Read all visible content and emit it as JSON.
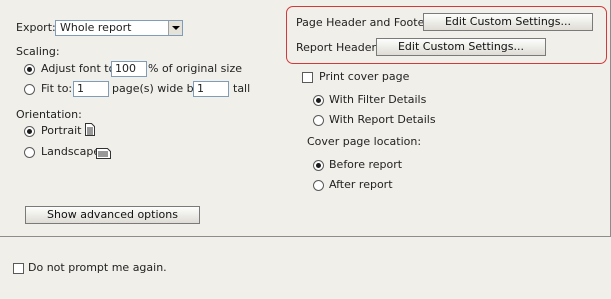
{
  "export": {
    "label": "Export:",
    "value": "Whole report"
  },
  "scaling": {
    "label": "Scaling:",
    "adjust_label": "Adjust font to",
    "adjust_value": "100",
    "adjust_suffix": "% of original size",
    "fit_label": "Fit to:",
    "fit_pages_value": "1",
    "fit_wide_by": "page(s) wide by",
    "fit_tall_value": "1",
    "fit_tall": "tall",
    "selected": "adjust"
  },
  "orientation": {
    "label": "Orientation:",
    "portrait_label": "Portrait",
    "landscape_label": "Landscape",
    "selected": "portrait"
  },
  "advanced_button": "Show advanced options",
  "header_footer": {
    "page_label": "Page Header and Footer:",
    "page_button": "Edit Custom Settings...",
    "report_label": "Report Header:",
    "report_button": "Edit Custom Settings...",
    "highlight_color": "#d23a3a"
  },
  "cover": {
    "print_label": "Print cover page",
    "print_checked": false,
    "with_filter": "With Filter Details",
    "with_report": "With Report Details",
    "details_selected": "filter",
    "location_label": "Cover page location:",
    "before": "Before report",
    "after": "After report",
    "location_selected": "before"
  },
  "footer": {
    "no_prompt_label": "Do not prompt me again.",
    "no_prompt_checked": false
  },
  "colors": {
    "background": "#f0efea",
    "input_border": "#7f9db9"
  }
}
